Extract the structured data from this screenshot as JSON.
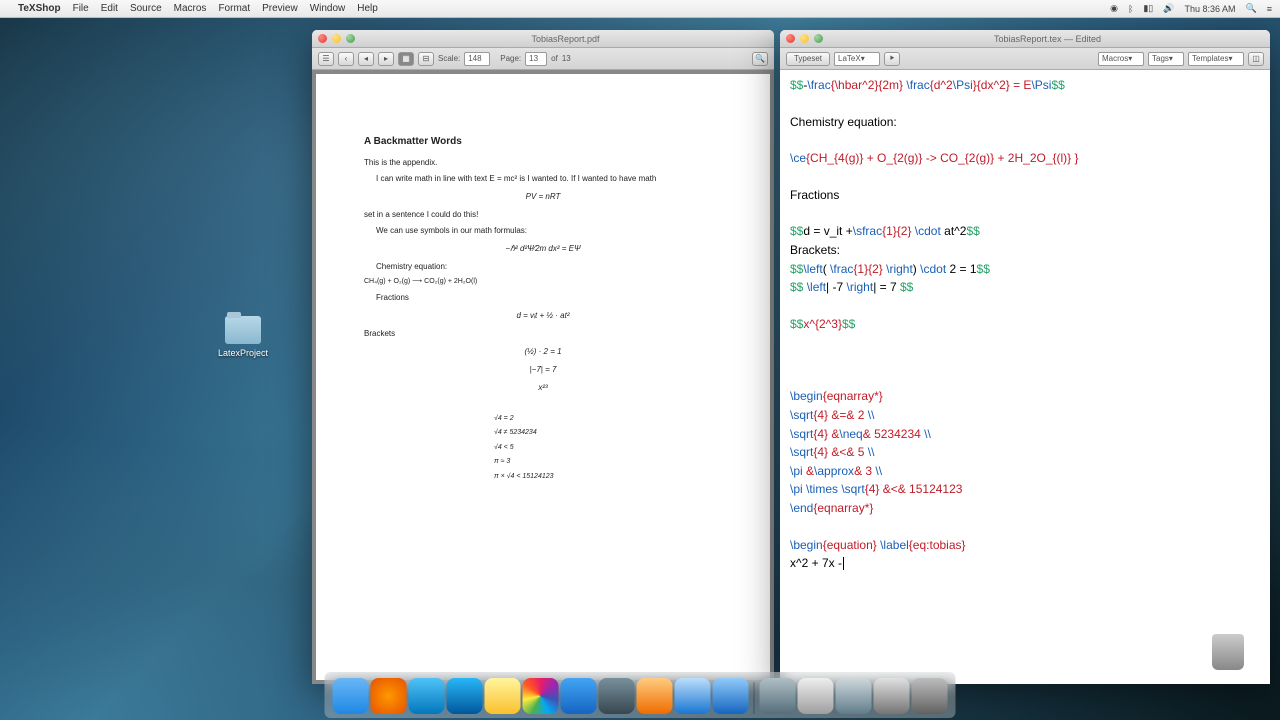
{
  "menubar": {
    "app": "TeXShop",
    "items": [
      "File",
      "Edit",
      "Source",
      "Macros",
      "Format",
      "Preview",
      "Window",
      "Help"
    ],
    "right": {
      "clock": "Thu 8:36 AM"
    }
  },
  "desktop": {
    "folder_label": "LatexProject"
  },
  "pdf_window": {
    "title": "TobiasReport.pdf",
    "toolbar": {
      "scale_label": "Scale:",
      "scale": "148",
      "page_label": "Page:",
      "page": "13",
      "of_label": "of",
      "total": "13"
    },
    "section": "A   Backmatter Words",
    "para1": "This is the appendix.",
    "para2": "I can write math in line with text E = mc² is I wanted to. If I wanted to have math",
    "eq1": "PV = nRT",
    "para3": "set in a sentence I could do this!",
    "para4": "We can use symbols in our math formulas:",
    "eq2": "−ℏ² d²Ψ⁄2m dx² = EΨ",
    "chem_label": "Chemistry equation:",
    "chem": "CH₄(g) + O₂(g) ⟶ CO₂(g) + 2H₂O(l)",
    "frac_label": "Fractions",
    "eq3": "d = vᵢt + ½ · at²",
    "brackets_label": "Brackets",
    "eq4": "(½) · 2 = 1",
    "eq5": "|−7| = 7",
    "eq6": "x²³",
    "align": [
      "√4   =   2",
      "√4   ≠   5234234",
      "√4   <   5",
      "π   ≈   3",
      "π × √4   <   15124123"
    ]
  },
  "tex_window": {
    "title": "TobiasReport.tex — Edited",
    "toolbar": {
      "typeset": "Typeset",
      "engine": "LaTeX",
      "macros": "Macros",
      "tags": "Tags",
      "templates": "Templates"
    },
    "lines": {
      "l1": {
        "a": "$$",
        "b": "-",
        "c": "\\frac",
        "d": "{\\hbar",
        "e": "^2}{2m}",
        "f": " \\frac",
        "g": "{d^2",
        "h": "\\Psi",
        "i": "}{dx^2} = E",
        "j": "\\Psi",
        "k": "$$"
      },
      "l3": "Chemistry equation:",
      "l5": {
        "a": "\\ce",
        "b": "{CH_{4(g)} + O_{2(g)} -> CO_{2(g)} + 2H_2O_{(l)}   }"
      },
      "l7": "Fractions",
      "l9": {
        "a": "$$",
        "b": "d = v_it +",
        "c": "\\sfrac",
        "d": "{1}{2}",
        "e": " \\cdot ",
        "f": "at^2",
        "g": "$$"
      },
      "l10": "Brackets:",
      "l11": {
        "a": "$$",
        "b": "\\left",
        "c": "(    ",
        "d": "\\frac",
        "e": "{1}{2}    ",
        "f": "\\right",
        "g": ")    ",
        "h": "\\cdot",
        "i": " 2 = 1",
        "j": "$$"
      },
      "l12": {
        "a": "$$ ",
        "b": "\\left",
        "c": "| -7 ",
        "d": "\\right",
        "e": "| = 7 ",
        "f": "$$"
      },
      "l14": {
        "a": "$$",
        "b": "x^{2^3}",
        "c": "$$"
      },
      "l18": {
        "a": "\\begin",
        "b": "{eqnarray*}"
      },
      "l19": {
        "a": "   \\sqrt",
        "b": "{4} &=& 2 ",
        "c": "\\\\"
      },
      "l20": {
        "a": "   \\sqrt",
        "b": "{4} &",
        "c": "\\neq",
        "d": "& 5234234  ",
        "e": "\\\\"
      },
      "l21": {
        "a": "   \\sqrt",
        "b": "{4} &<& 5  ",
        "c": "\\\\"
      },
      "l22": {
        "a": "   \\pi ",
        "b": "&",
        "c": "\\approx",
        "d": "& 3 ",
        "e": "\\\\"
      },
      "l23": {
        "a": "   \\pi \\times \\sqrt",
        "b": "{4} &<& 15124123"
      },
      "l24": {
        "a": "\\end",
        "b": "{eqnarray*}"
      },
      "l26": {
        "a": "\\begin",
        "b": "{equation}",
        "c": " \\label",
        "d": "{eq:tobias}"
      },
      "l27": "x^2 + 7x -"
    }
  },
  "dock": {
    "apps": [
      "Finder",
      "Firefox",
      "Activity",
      "Skype",
      "Notes",
      "iPhoto",
      "Mail",
      "Terminal",
      "Preview",
      "AppStore",
      "Safari",
      "",
      "TeXShop",
      "TextEdit",
      "Settings",
      "Trash"
    ]
  }
}
